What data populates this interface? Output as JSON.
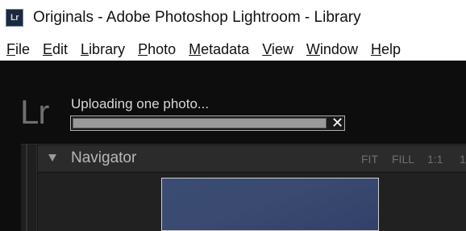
{
  "window": {
    "icon_text": "Lr",
    "title": "Originals - Adobe Photoshop Lightroom - Library"
  },
  "menubar": {
    "items": [
      {
        "label": "File",
        "accel": "F",
        "rest": "ile"
      },
      {
        "label": "Edit",
        "accel": "E",
        "rest": "dit"
      },
      {
        "label": "Library",
        "accel": "L",
        "rest": "ibrary"
      },
      {
        "label": "Photo",
        "accel": "P",
        "rest": "hoto"
      },
      {
        "label": "Metadata",
        "accel": "M",
        "rest": "etadata"
      },
      {
        "label": "View",
        "accel": "V",
        "rest": "iew"
      },
      {
        "label": "Window",
        "accel": "W",
        "rest": "indow"
      },
      {
        "label": "Help",
        "accel": "H",
        "rest": "elp"
      }
    ]
  },
  "identity_plate": {
    "logo_text": "Lr"
  },
  "upload": {
    "status_text": "Uploading one photo...",
    "progress": 0.94,
    "close_glyph": "✕"
  },
  "navigator": {
    "title": "Navigator",
    "zoom_options": [
      "FIT",
      "FILL",
      "1:1",
      "1"
    ]
  },
  "colors": {
    "accent_progress": "#9a9a9a",
    "workspace_bg": "#0d0d0d",
    "panel_bg": "#2b2b2b"
  }
}
